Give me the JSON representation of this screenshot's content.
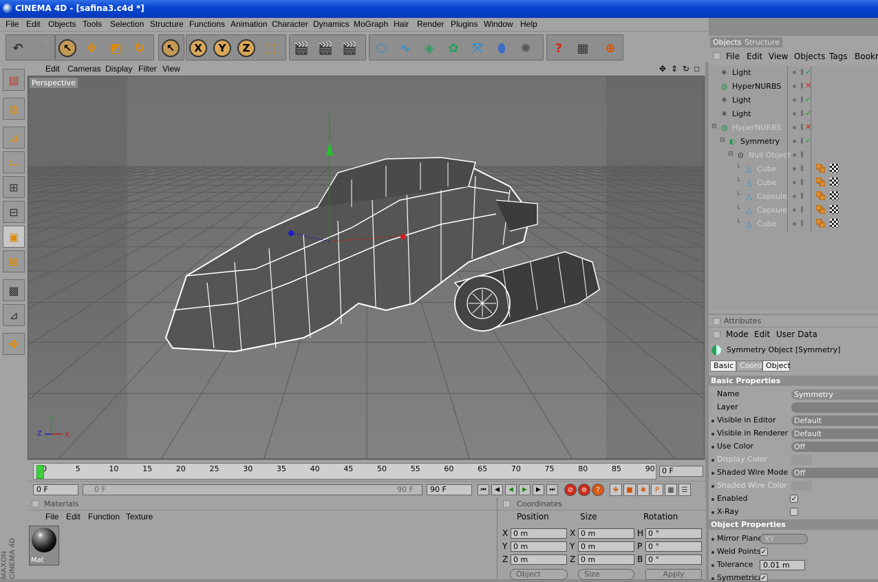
{
  "title": "CINEMA 4D - [safina3.c4d *]",
  "menu": [
    "File",
    "Edit",
    "Objects",
    "Tools",
    "Selection",
    "Structure",
    "Functions",
    "Animation",
    "Character",
    "Dynamics",
    "MoGraph",
    "Hair",
    "Render",
    "Plugins",
    "Window",
    "Help"
  ],
  "viewport": {
    "menu": [
      "Edit",
      "Cameras",
      "Display",
      "Filter",
      "View"
    ],
    "label": "Perspective",
    "axis": {
      "x": "X",
      "y": "Y",
      "z": "Z"
    }
  },
  "timeline": {
    "ticks": [
      "0",
      "5",
      "10",
      "15",
      "20",
      "25",
      "30",
      "35",
      "40",
      "45",
      "50",
      "55",
      "60",
      "65",
      "70",
      "75",
      "80",
      "85",
      "90"
    ],
    "current": "0 F",
    "start": "0 F",
    "range_start": "0 F",
    "range_end": "90 F",
    "end": "90 F",
    "progress": 0
  },
  "materials": {
    "header": "Materials",
    "menu": [
      "File",
      "Edit",
      "Function",
      "Texture"
    ],
    "items": [
      {
        "name": "Mat"
      }
    ]
  },
  "coordinates": {
    "header": "Coordinates",
    "columns": [
      "Position",
      "Size",
      "Rotation"
    ],
    "rows": [
      {
        "a": "X",
        "pos": "0 m",
        "b": "X",
        "size": "0 m",
        "c": "H",
        "rot": "0 °"
      },
      {
        "a": "Y",
        "pos": "0 m",
        "b": "Y",
        "size": "0 m",
        "c": "P",
        "rot": "0 °"
      },
      {
        "a": "Z",
        "pos": "0 m",
        "b": "Z",
        "size": "0 m",
        "c": "B",
        "rot": "0 °"
      }
    ],
    "mode": "Object",
    "size_mode": "Size",
    "apply": "Apply"
  },
  "objects": {
    "tabs": [
      "Objects",
      "Structure"
    ],
    "menu": [
      "File",
      "Edit",
      "View",
      "Objects",
      "Tags",
      "Bookm"
    ],
    "items": [
      {
        "name": "Light",
        "icon": "light-icon",
        "indent": 0,
        "state": "check",
        "dim": false
      },
      {
        "name": "HyperNURBS",
        "icon": "hypernurbs-icon",
        "indent": 0,
        "state": "cross",
        "dim": false
      },
      {
        "name": "Light",
        "icon": "light-icon",
        "indent": 0,
        "state": "check",
        "dim": false
      },
      {
        "name": "Light",
        "icon": "light-icon",
        "indent": 0,
        "state": "check",
        "dim": false
      },
      {
        "name": "HyperNURBS",
        "icon": "hypernurbs-icon",
        "indent": 0,
        "state": "cross",
        "dim": true
      },
      {
        "name": "Symmetry",
        "icon": "symmetry-icon",
        "indent": 1,
        "state": "check",
        "dim": false
      },
      {
        "name": "Null Object",
        "icon": "null-icon",
        "indent": 2,
        "state": "",
        "dim": true
      },
      {
        "name": "Cube",
        "icon": "polygon-icon",
        "indent": 3,
        "state": "",
        "dim": true,
        "tags": true
      },
      {
        "name": "Cube",
        "icon": "polygon-icon",
        "indent": 3,
        "state": "",
        "dim": true,
        "tags": true
      },
      {
        "name": "Capsule",
        "icon": "polygon-icon",
        "indent": 3,
        "state": "",
        "dim": true,
        "tags": true
      },
      {
        "name": "Capsule",
        "icon": "polygon-icon",
        "indent": 3,
        "state": "",
        "dim": true,
        "tags": true
      },
      {
        "name": "Cube",
        "icon": "polygon-icon",
        "indent": 3,
        "state": "",
        "dim": true,
        "tags": true
      }
    ]
  },
  "attributes": {
    "header": "Attributes",
    "menu": [
      "Mode",
      "Edit",
      "User Data"
    ],
    "object_title": "Symmetry Object [Symmetry]",
    "tabs": [
      "Basic",
      "Coord",
      "Object"
    ],
    "basic_title": "Basic Properties",
    "basic": [
      {
        "label": "Name",
        "value": "Symmetry"
      },
      {
        "label": "Layer",
        "value": ""
      },
      {
        "label": "Visible in Editor",
        "value": "Default"
      },
      {
        "label": "Visible in Renderer",
        "value": "Default"
      },
      {
        "label": "Use Color",
        "value": "Off"
      },
      {
        "label": "Display Color",
        "value": ""
      },
      {
        "label": "Shaded Wire Mode",
        "value": "Off"
      },
      {
        "label": "Shaded Wire Color",
        "value": ""
      },
      {
        "label": "Enabled",
        "value": "✓"
      },
      {
        "label": "X-Ray",
        "value": ""
      }
    ],
    "object_props_title": "Object Properties",
    "object_props": [
      {
        "label": "Mirror Plane",
        "value": "XY"
      },
      {
        "label": "Weld Points",
        "value": "✓"
      },
      {
        "label": "Tolerance",
        "value": "0.01 m"
      },
      {
        "label": "Symmetrical",
        "value": "✓"
      }
    ]
  },
  "colors": {
    "titlebar": "#0a46d1",
    "accent": "#d9a65a",
    "selected_tab": "#ffffff",
    "panel": "#a3a3a3"
  }
}
